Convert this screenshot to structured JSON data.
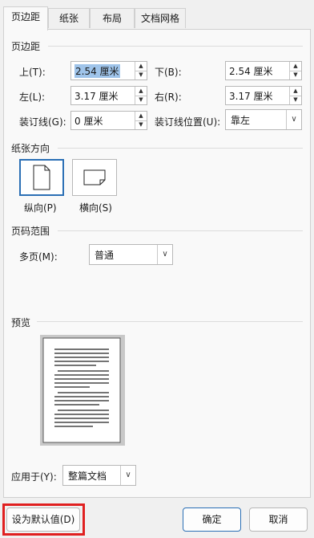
{
  "tabs": [
    "页边距",
    "纸张",
    "布局",
    "文档网格"
  ],
  "margins": {
    "section_title": "页边距",
    "top_label": "上(T):",
    "top_value": "2.54 厘米",
    "bottom_label": "下(B):",
    "bottom_value": "2.54 厘米",
    "left_label": "左(L):",
    "left_value": "3.17 厘米",
    "right_label": "右(R):",
    "right_value": "3.17 厘米",
    "gutter_label": "装订线(G):",
    "gutter_value": "0 厘米",
    "gutter_pos_label": "装订线位置(U):",
    "gutter_pos_value": "靠左"
  },
  "orientation": {
    "section_title": "纸张方向",
    "portrait_label": "纵向(P)",
    "landscape_label": "横向(S)",
    "selected": "portrait"
  },
  "pages": {
    "section_title": "页码范围",
    "multiple_label": "多页(M):",
    "multiple_value": "普通"
  },
  "preview": {
    "section_title": "预览"
  },
  "apply": {
    "label": "应用于(Y):",
    "value": "整篇文档"
  },
  "buttons": {
    "default": "设为默认值(D)",
    "ok": "确定",
    "cancel": "取消"
  },
  "colors": {
    "accent": "#2b6fb5",
    "highlight": "#e02020",
    "selection": "#9fc4ea"
  }
}
